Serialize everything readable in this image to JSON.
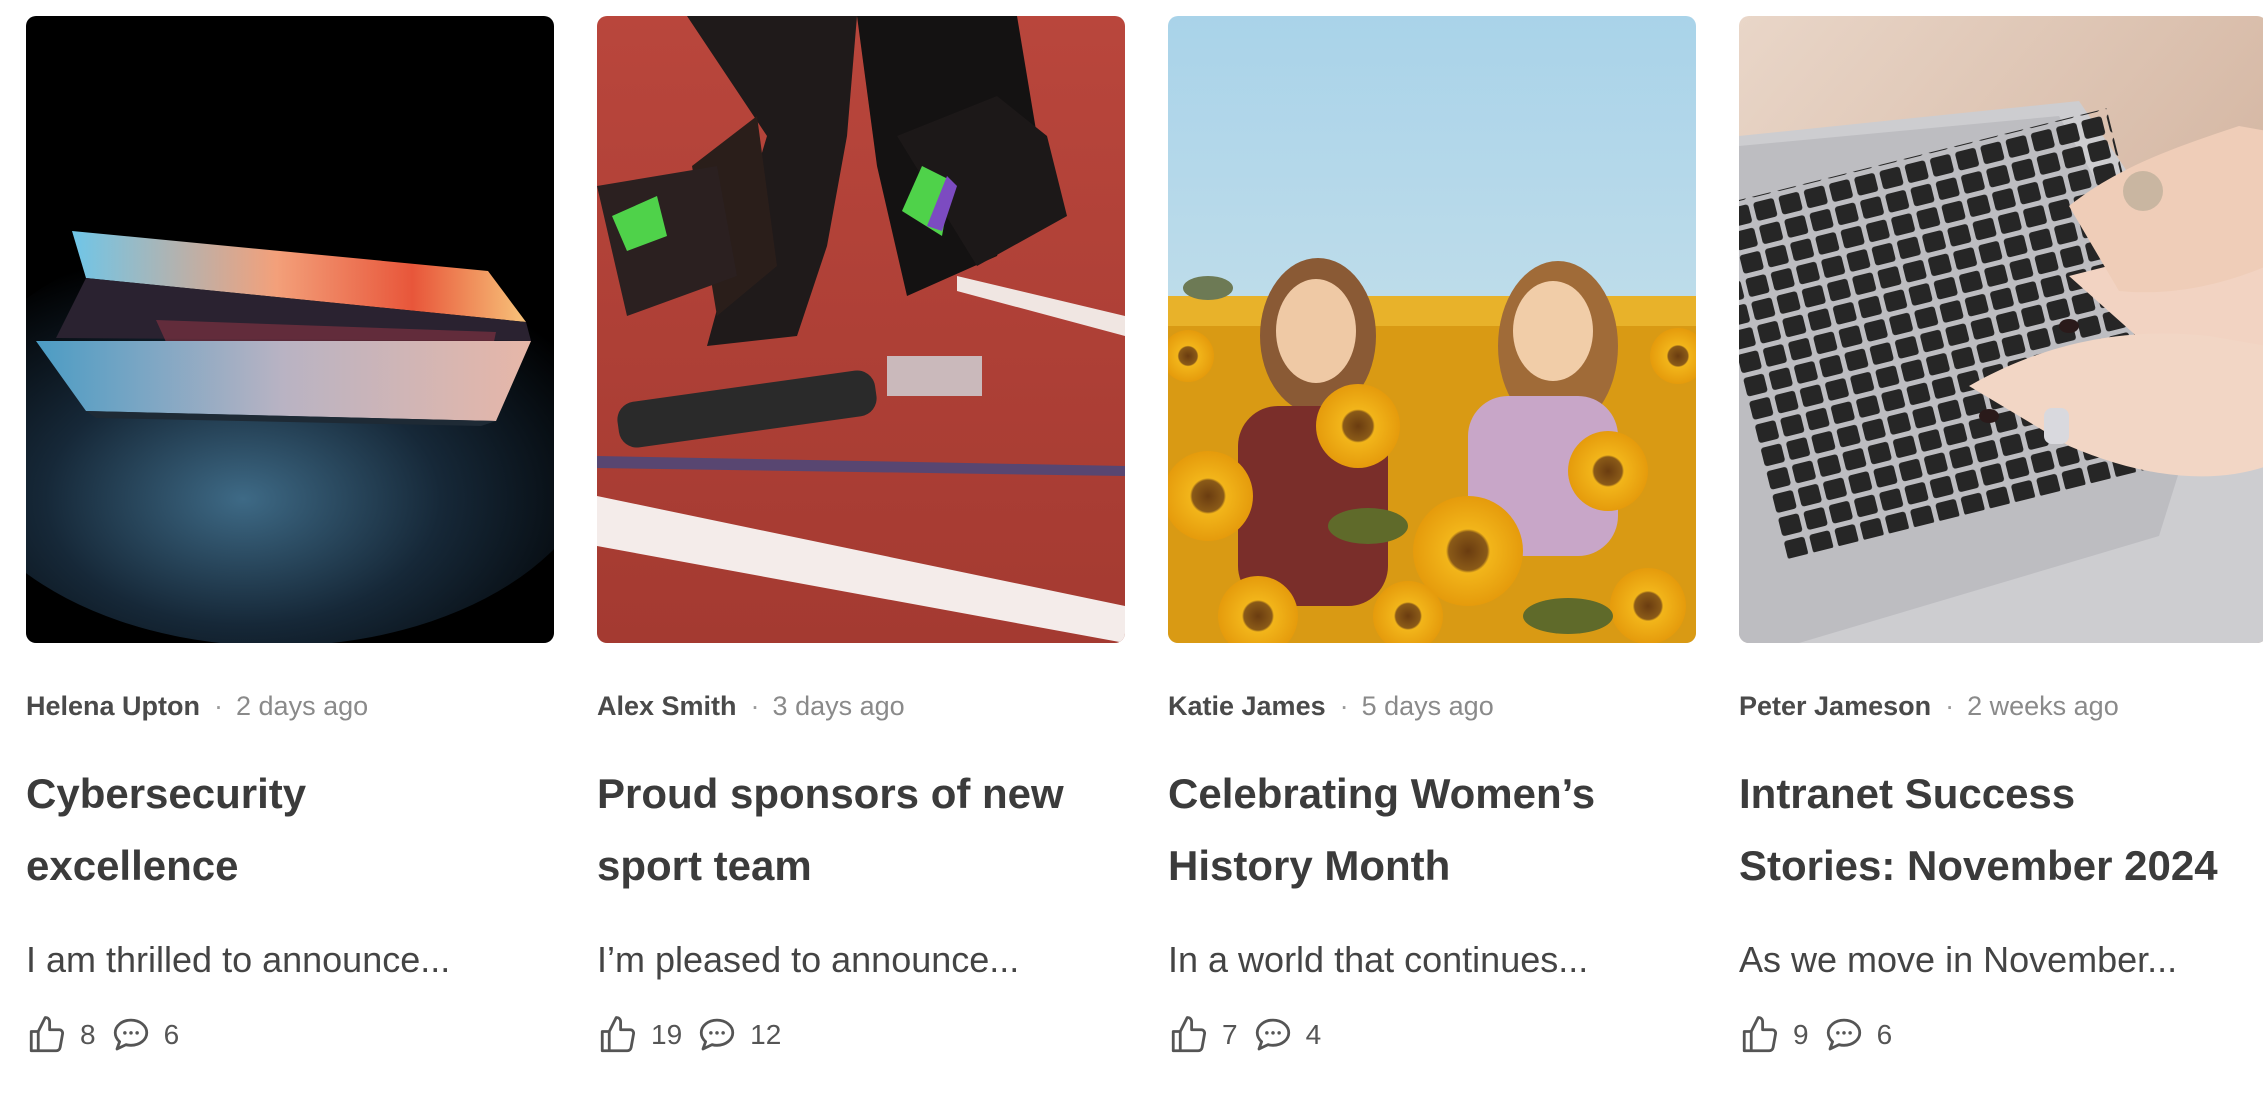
{
  "posts": [
    {
      "author": "Helena Upton",
      "separator": "·",
      "date": "2 days ago",
      "title_line1": "Cybersecurity",
      "title_line2": "excellence",
      "excerpt": "I am thrilled to announce...",
      "likes": "8",
      "comments": "6"
    },
    {
      "author": "Alex Smith",
      "separator": "·",
      "date": "3 days ago",
      "title_line1": "Proud sponsors of new",
      "title_line2": "sport team",
      "excerpt": "I’m pleased to announce...",
      "likes": "19",
      "comments": "12"
    },
    {
      "author": "Katie James",
      "separator": "·",
      "date": "5 days ago",
      "title_line1": "Celebrating Women’s",
      "title_line2": "History Month",
      "excerpt": "In a world that continues...",
      "likes": "7",
      "comments": "4"
    },
    {
      "author": "Peter Jameson",
      "separator": "·",
      "date": "2 weeks ago",
      "title_line1": "Intranet Success",
      "title_line2": "Stories: November 2024",
      "excerpt": "As we move in November...",
      "likes": "9",
      "comments": "6"
    }
  ],
  "icons": {
    "like": "thumbs-up-icon",
    "comment": "comment-bubble-icon"
  },
  "colors": {
    "text_dark": "#3b3b3b",
    "meta_gray": "#8a8a8a",
    "track_red": "#a83a32",
    "sunflower_yellow": "#f2b51a"
  }
}
